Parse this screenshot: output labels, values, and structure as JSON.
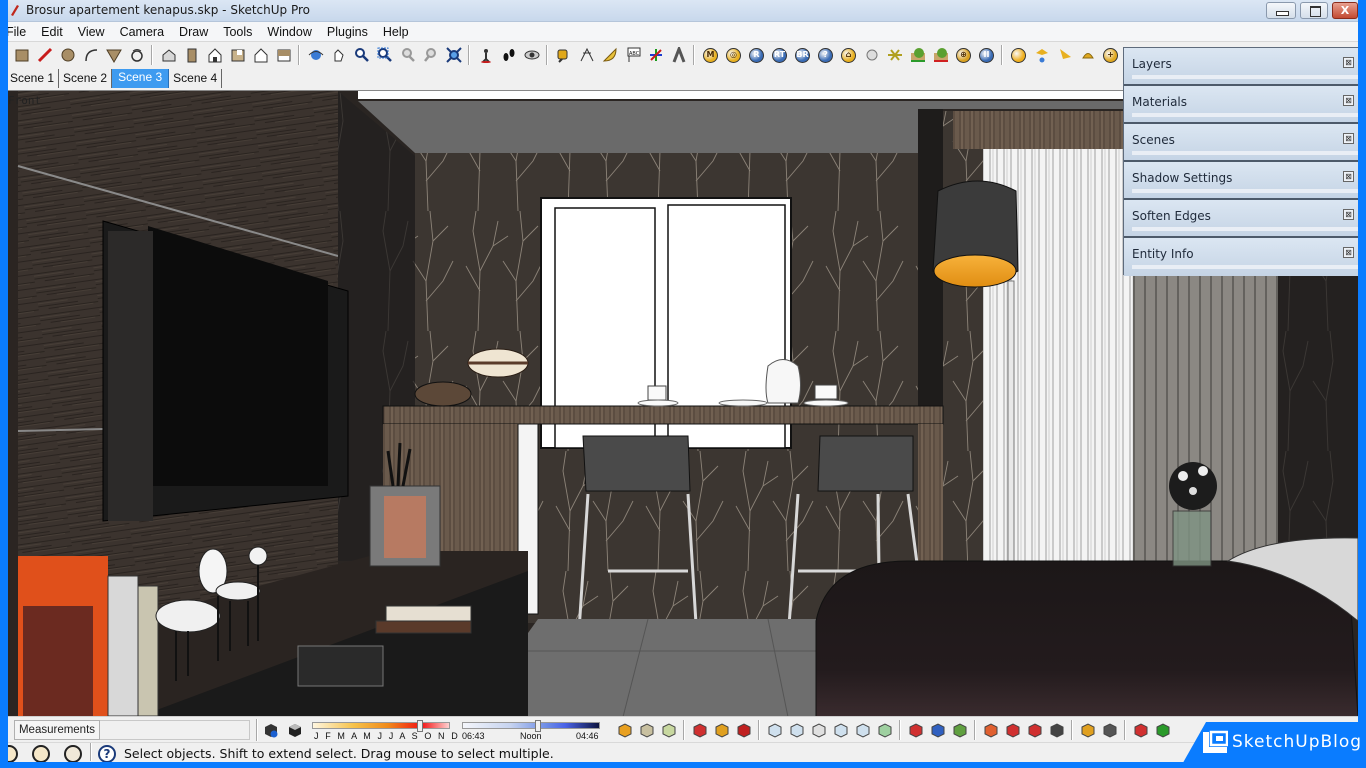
{
  "window": {
    "title": "Brosur apartement kenapus.skp - SketchUp Pro",
    "close_glyph": "X"
  },
  "menu": [
    "File",
    "Edit",
    "View",
    "Camera",
    "Draw",
    "Tools",
    "Window",
    "Plugins",
    "Help"
  ],
  "toolbar": {
    "groups": [
      [
        "rectangle-icon",
        "pencil-line-icon",
        "circle-icon",
        "arc-icon",
        "push-pull-icon",
        "follow-me-icon"
      ],
      [
        "iso-view-icon",
        "top-view-icon",
        "front-view-icon",
        "right-view-icon",
        "back-view-icon",
        "left-view-icon"
      ],
      [
        "orbit-icon",
        "pan-icon",
        "zoom-icon",
        "zoom-window-icon",
        "previous-view-icon",
        "next-view-icon",
        "zoom-extents-icon"
      ],
      [
        "position-camera-icon",
        "walk-icon",
        "look-around-icon"
      ],
      [
        "tape-measure-icon",
        "dimension-icon",
        "protractor-icon",
        "text-icon",
        "axes-icon",
        "3d-text-icon"
      ],
      [
        "plugin-m-icon",
        "plugin-tag-icon",
        "plugin-r-icon",
        "plugin-rt-icon",
        "plugin-br-icon",
        "plugin-help-icon",
        "plugin-tag2-icon",
        "plugin-light-icon",
        "plugin-star-icon",
        "plugin-render-icon",
        "plugin-render2-icon",
        "plugin-target-icon",
        "plugin-pause-icon"
      ],
      [
        "omni-light-icon",
        "spot-light-icon",
        "direction-light-icon",
        "dome-light-icon",
        "sphere-light-icon"
      ]
    ]
  },
  "scenes": {
    "tabs": [
      "Scene 1",
      "Scene 2",
      "Scene 3",
      "Scene 4"
    ],
    "active": "Scene 3"
  },
  "viewport": {
    "view_label": "Front"
  },
  "tray": {
    "panels": [
      "Layers",
      "Materials",
      "Scenes",
      "Shadow Settings",
      "Soften Edges",
      "Entity Info"
    ],
    "close_glyph": "⊠"
  },
  "status": {
    "measurements_label": "Measurements",
    "measurements_value": "",
    "shadow": {
      "months": "J F M A M J J A S O N D",
      "date_fraction": 0.78,
      "time_start": "06:43",
      "time_mid": "Noon",
      "time_end": "04:46",
      "time_fraction": 0.55
    },
    "hint": "Select objects. Shift to extend select. Drag mouse to select multiple."
  },
  "watermark": {
    "text": "SketchUpBlog"
  },
  "colors": {
    "accent": "#3e9bf0",
    "frame": "#0a7cff",
    "lamp_glow": "#f5a02a"
  }
}
